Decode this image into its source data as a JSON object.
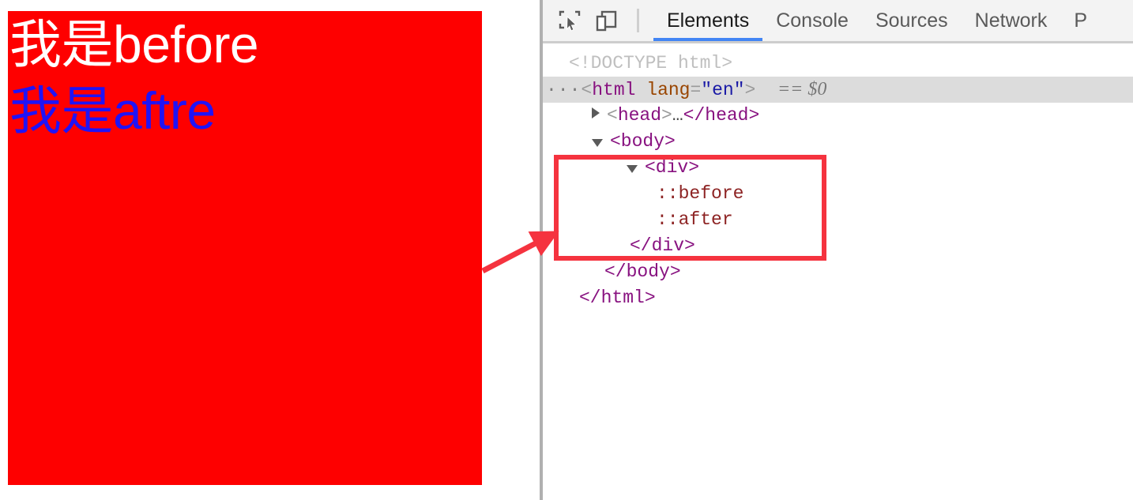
{
  "page": {
    "div": {
      "background_color": "#fe0000",
      "before_text": "我是before",
      "before_color": "#ffffff",
      "after_text": "我是aftre",
      "after_color": "#2013f5"
    }
  },
  "devtools": {
    "toolbar": {
      "inspect_icon": "inspect-element-icon",
      "device_icon": "device-toolbar-icon",
      "tabs": [
        {
          "label": "Elements",
          "active": true
        },
        {
          "label": "Console",
          "active": false
        },
        {
          "label": "Sources",
          "active": false
        },
        {
          "label": "Network",
          "active": false
        },
        {
          "label": "P",
          "active": false
        }
      ],
      "active_underline_color": "#4285f4"
    },
    "dom": {
      "doctype": "<!DOCTYPE html>",
      "html_dots": "···",
      "html_open_lt": "<",
      "html_tag": "html",
      "html_attr_name": "lang",
      "html_attr_eq": "=",
      "html_attr_value": "\"en\"",
      "html_open_gt": ">",
      "html_selected_ref": "== $0",
      "head_lt": "<",
      "head_tag": "head",
      "head_gt": ">",
      "head_ellipsis": "…",
      "head_close": "</head>",
      "body_open": "<body>",
      "div_open": "<div>",
      "pseudo_before": "::before",
      "pseudo_after": "::after",
      "div_close": "</div>",
      "body_close": "</body>",
      "html_close": "</html>"
    }
  },
  "annotation": {
    "highlight_color": "#f5333f",
    "target": "div-with-pseudo-elements"
  }
}
